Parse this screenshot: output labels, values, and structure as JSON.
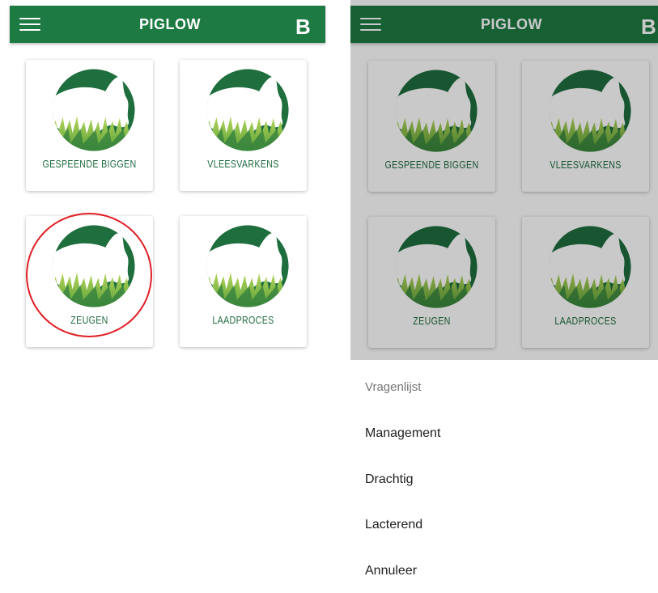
{
  "colors": {
    "primary": "#1e7a43",
    "label": "#1f6b3e",
    "highlight": "#e01e24"
  },
  "left_screen": {
    "appbar": {
      "menu_icon": "hamburger-icon",
      "title": "PIGLOW",
      "brand": "B"
    },
    "cards": [
      {
        "label": "GESPEENDE BIGGEN"
      },
      {
        "label": "VLEESVARKENS"
      },
      {
        "label": "ZEUGEN"
      },
      {
        "label": "LAADPROCES"
      }
    ]
  },
  "right_screen": {
    "appbar": {
      "menu_icon": "hamburger-icon",
      "title": "PIGLOW",
      "brand": "B"
    },
    "cards": [
      {
        "label": "GESPEENDE BIGGEN"
      },
      {
        "label": "VLEESVARKENS"
      },
      {
        "label": "ZEUGEN"
      },
      {
        "label": "LAADPROCES"
      }
    ],
    "sheet": {
      "title": "Vragenlijst",
      "items": [
        {
          "label": "Management"
        },
        {
          "label": "Drachtig"
        },
        {
          "label": "Lacterend"
        },
        {
          "label": "Annuleer"
        }
      ]
    }
  }
}
